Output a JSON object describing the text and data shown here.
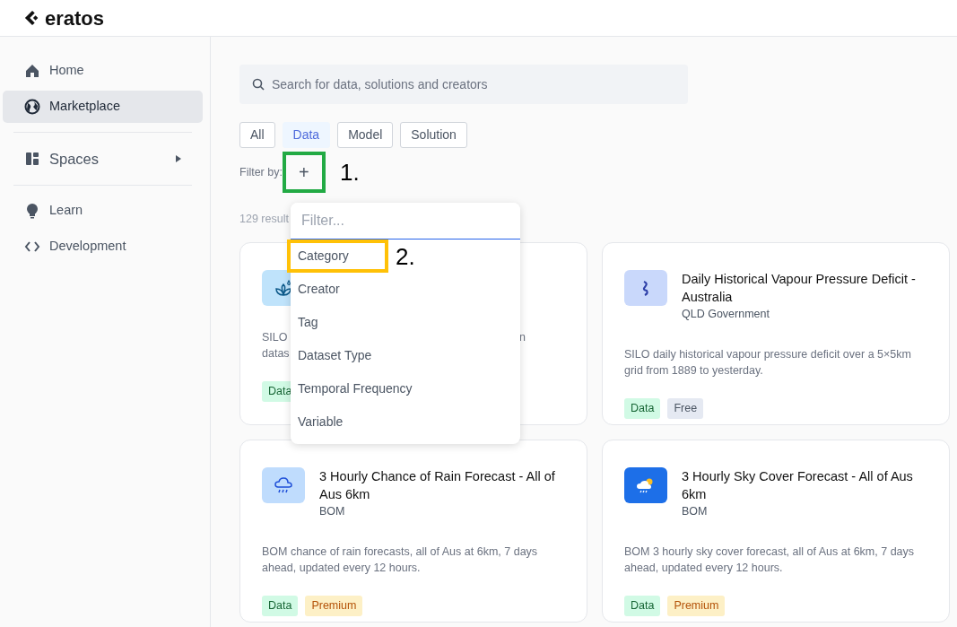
{
  "brand": "eratos",
  "sidebar": {
    "items": [
      {
        "label": "Home",
        "selected": false
      },
      {
        "label": "Marketplace",
        "selected": true
      },
      {
        "label": "Spaces",
        "selected": false,
        "expandable": true
      },
      {
        "label": "Learn",
        "selected": false
      },
      {
        "label": "Development",
        "selected": false
      }
    ]
  },
  "search": {
    "placeholder": "Search for data, solutions and creators"
  },
  "type_tabs": [
    {
      "label": "All",
      "selected": false
    },
    {
      "label": "Data",
      "selected": true
    },
    {
      "label": "Model",
      "selected": false
    },
    {
      "label": "Solution",
      "selected": false
    }
  ],
  "filter_label": "Filter by:",
  "add_filter_button": "+",
  "results_count": "129 result",
  "filter_menu": {
    "placeholder": "Filter...",
    "options": [
      "Category",
      "Creator",
      "Tag",
      "Dataset Type",
      "Temporal Frequency",
      "Variable"
    ]
  },
  "annotations": [
    {
      "label": "1.",
      "color": "#22aa44"
    },
    {
      "label": "2.",
      "color": "#ffc107"
    }
  ],
  "covered_card": {
    "description_fragments": [
      "SILO",
      "datas"
    ],
    "description_tail": "n",
    "tags": [
      {
        "label": "Data",
        "kind": "type"
      }
    ]
  },
  "cards": [
    {
      "title": "Daily Historical Vapour Pressure Deficit - Australia",
      "creator": "QLD Government",
      "description": "SILO daily historical vapour pressure deficit over a 5×5km grid from 1889 to yesterday.",
      "tags": [
        {
          "label": "Data",
          "kind": "type"
        },
        {
          "label": "Free",
          "kind": "free"
        }
      ]
    },
    {
      "title": "3 Hourly Chance of Rain Forecast - All of Aus 6km",
      "creator": "BOM",
      "description": "BOM chance of rain forecasts, all of Aus at 6km, 7 days ahead, updated every 12 hours.",
      "tags": [
        {
          "label": "Data",
          "kind": "type"
        },
        {
          "label": "Premium",
          "kind": "premium"
        }
      ]
    },
    {
      "title": "3 Hourly Sky Cover Forecast - All of Aus 6km",
      "creator": "BOM",
      "description": "BOM 3 hourly sky cover forecast, all of Aus at 6km, 7 days ahead, updated every 12 hours.",
      "tags": [
        {
          "label": "Data",
          "kind": "type"
        },
        {
          "label": "Premium",
          "kind": "premium"
        }
      ]
    }
  ]
}
